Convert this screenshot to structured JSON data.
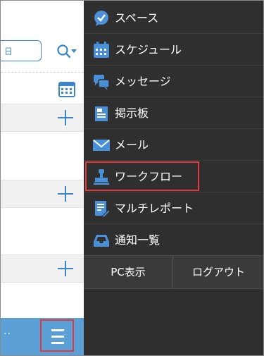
{
  "left_panel": {
    "date_field_value": "日",
    "bottom_dots": "··"
  },
  "menu": {
    "items": [
      {
        "label": "スペース",
        "icon": "space-icon"
      },
      {
        "label": "スケジュール",
        "icon": "calendar-icon"
      },
      {
        "label": "メッセージ",
        "icon": "message-icon"
      },
      {
        "label": "掲示板",
        "icon": "bulletin-board-icon"
      },
      {
        "label": "メール",
        "icon": "mail-icon"
      },
      {
        "label": "ワークフロー",
        "icon": "workflow-stamp-icon"
      },
      {
        "label": "マルチレポート",
        "icon": "multi-report-icon"
      },
      {
        "label": "通知一覧",
        "icon": "notification-tray-icon"
      }
    ],
    "footer": {
      "pc_view": "PC表示",
      "logout": "ログアウト"
    }
  },
  "colors": {
    "accent_blue": "#3a86c8",
    "menu_background": "#2f2f2f",
    "highlight_red": "#e23a3a",
    "bottom_bar": "#5a9fd6"
  }
}
